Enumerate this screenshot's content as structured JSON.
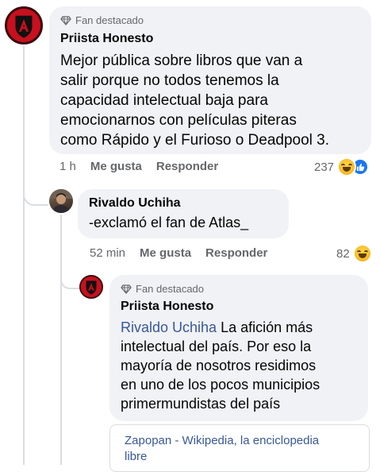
{
  "comments": [
    {
      "badge": "Fan destacado",
      "author": "Priista Honesto",
      "text_lines": [
        "Mejor pública sobre libros que van a",
        "salir porque no todos tenemos la",
        "capacidad intelectual baja para",
        "emocionarnos con películas piteras",
        "como Rápido y el Furioso o Deadpool 3."
      ],
      "time": "1 h",
      "like_label": "Me gusta",
      "reply_label": "Responder",
      "reaction_count": "237",
      "reactions": [
        "haha-icon",
        "like-icon"
      ]
    },
    {
      "author": "Rivaldo Uchiha",
      "text": "-exclamó el fan de Atlas_",
      "time": "52 min",
      "like_label": "Me gusta",
      "reply_label": "Responder",
      "reaction_count": "82",
      "reactions": [
        "haha-icon"
      ]
    },
    {
      "badge": "Fan destacado",
      "author": "Priista Honesto",
      "mention": "Rivaldo Uchiha",
      "text_first": " La afición más",
      "text_lines": [
        "intelectual del país. Por eso la",
        "mayoría de nosotros residimos",
        "en uno de los pocos municipios",
        "primermundistas del país"
      ]
    }
  ],
  "link_preview": {
    "title_line1": "Zapopan - Wikipedia, la enciclopedia",
    "title_line2": "libre"
  },
  "colors": {
    "bubble": "#f0f2f5",
    "secondary_text": "#65676b",
    "mention": "#385898",
    "atlas_red": "#b3121d"
  }
}
